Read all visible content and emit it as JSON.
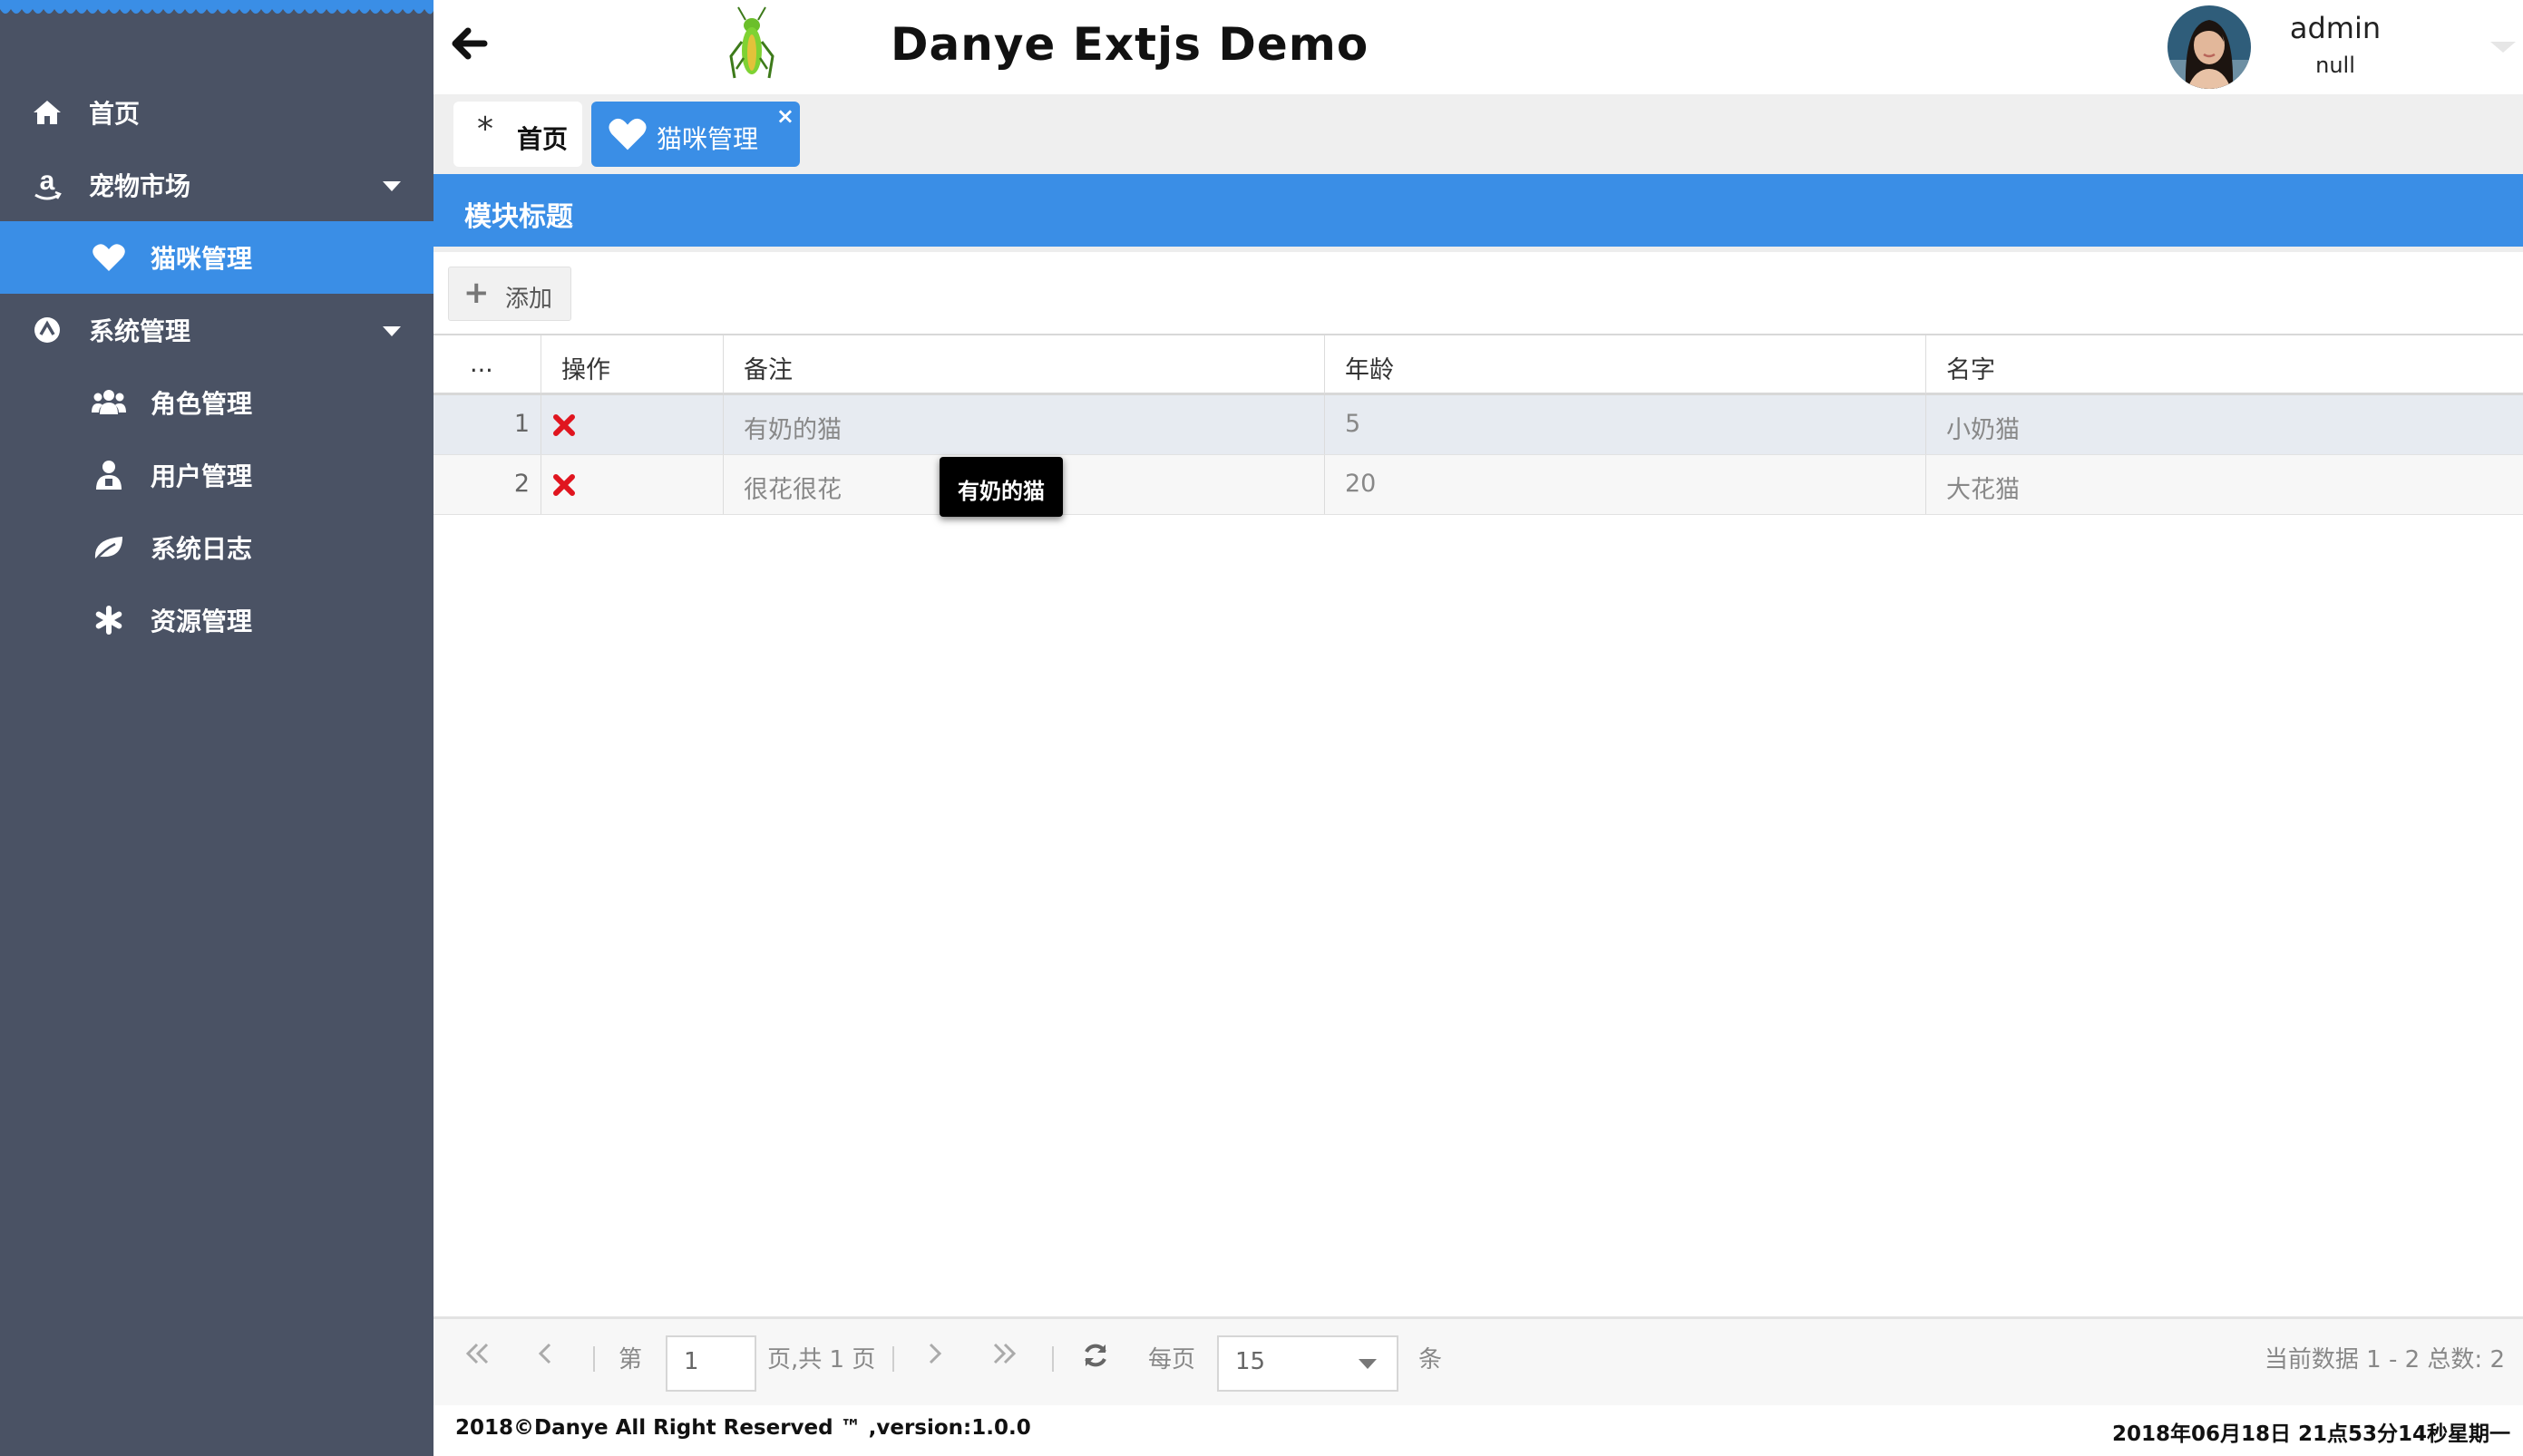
{
  "app": {
    "title": "Danye Extjs Demo",
    "user_name": "admin",
    "user_role": "null"
  },
  "sidebar": {
    "items": [
      {
        "label": "首页",
        "icon": "home-icon"
      },
      {
        "label": "宠物市场",
        "icon": "amazon-icon"
      },
      {
        "label": "猫咪管理",
        "icon": "heart-icon",
        "active": true
      },
      {
        "label": "系统管理",
        "icon": "system-icon"
      },
      {
        "label": "角色管理",
        "icon": "users-icon"
      },
      {
        "label": "用户管理",
        "icon": "user-icon"
      },
      {
        "label": "系统日志",
        "icon": "leaf-icon"
      },
      {
        "label": "资源管理",
        "icon": "asterisk-icon"
      }
    ]
  },
  "tabs": [
    {
      "label": "首页",
      "icon": "asterisk-icon"
    },
    {
      "label": "猫咪管理",
      "icon": "heart-icon",
      "close": "×"
    }
  ],
  "panel": {
    "title": "模块标题",
    "add_label": "添加"
  },
  "grid": {
    "columns": [
      "...",
      "操作",
      "备注",
      "年龄",
      "名字"
    ],
    "rows": [
      {
        "index": "1",
        "remark": "有奶的猫",
        "age": "5",
        "name": "小奶猫"
      },
      {
        "index": "2",
        "remark": "很花很花",
        "age": "20",
        "name": "大花猫"
      }
    ],
    "tooltip": "有奶的猫"
  },
  "pager": {
    "page_prefix": "第",
    "current_page": "1",
    "page_suffix": "页,共 1 页",
    "per_page_label": "每页",
    "per_page_value": "15",
    "per_page_unit": "条",
    "summary": "当前数据 1 - 2 总数:  2"
  },
  "footer": {
    "copyright": "2018©Danye All Right Reserved ™ ,version:1.0.0",
    "datetime": "2018年06月18日 21点53分14秒星期一"
  },
  "colors": {
    "sidebar_bg": "#4a5264",
    "accent": "#3a8ee6",
    "delete": "#e0151f"
  }
}
